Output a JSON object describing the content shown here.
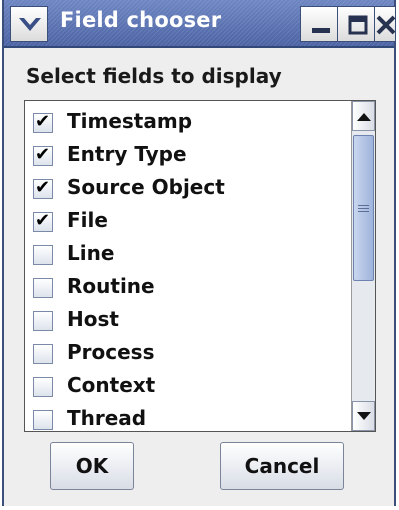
{
  "window": {
    "title": "Field chooser"
  },
  "titlebar_buttons": {
    "menu_icon": "chevron-down-icon",
    "minimize_icon": "minimize-icon",
    "maximize_icon": "maximize-icon",
    "close_icon": "close-icon"
  },
  "heading": "Select fields to display",
  "fields": [
    {
      "label": "Timestamp",
      "checked": true,
      "check_glyph": "✔"
    },
    {
      "label": "Entry Type",
      "checked": true,
      "check_glyph": "✔"
    },
    {
      "label": "Source Object",
      "checked": true,
      "check_glyph": "✔"
    },
    {
      "label": "File",
      "checked": true,
      "check_glyph": "✔"
    },
    {
      "label": "Line",
      "checked": false,
      "check_glyph": ""
    },
    {
      "label": "Routine",
      "checked": false,
      "check_glyph": ""
    },
    {
      "label": "Host",
      "checked": false,
      "check_glyph": ""
    },
    {
      "label": "Process",
      "checked": false,
      "check_glyph": ""
    },
    {
      "label": "Context",
      "checked": false,
      "check_glyph": ""
    },
    {
      "label": "Thread",
      "checked": false,
      "check_glyph": ""
    }
  ],
  "buttons": {
    "ok_label": "OK",
    "cancel_label": "Cancel"
  },
  "colors": {
    "titlebar": "#5a72b2",
    "window_bg": "#eeeeee",
    "scroll_thumb": "#9fb4dc"
  }
}
